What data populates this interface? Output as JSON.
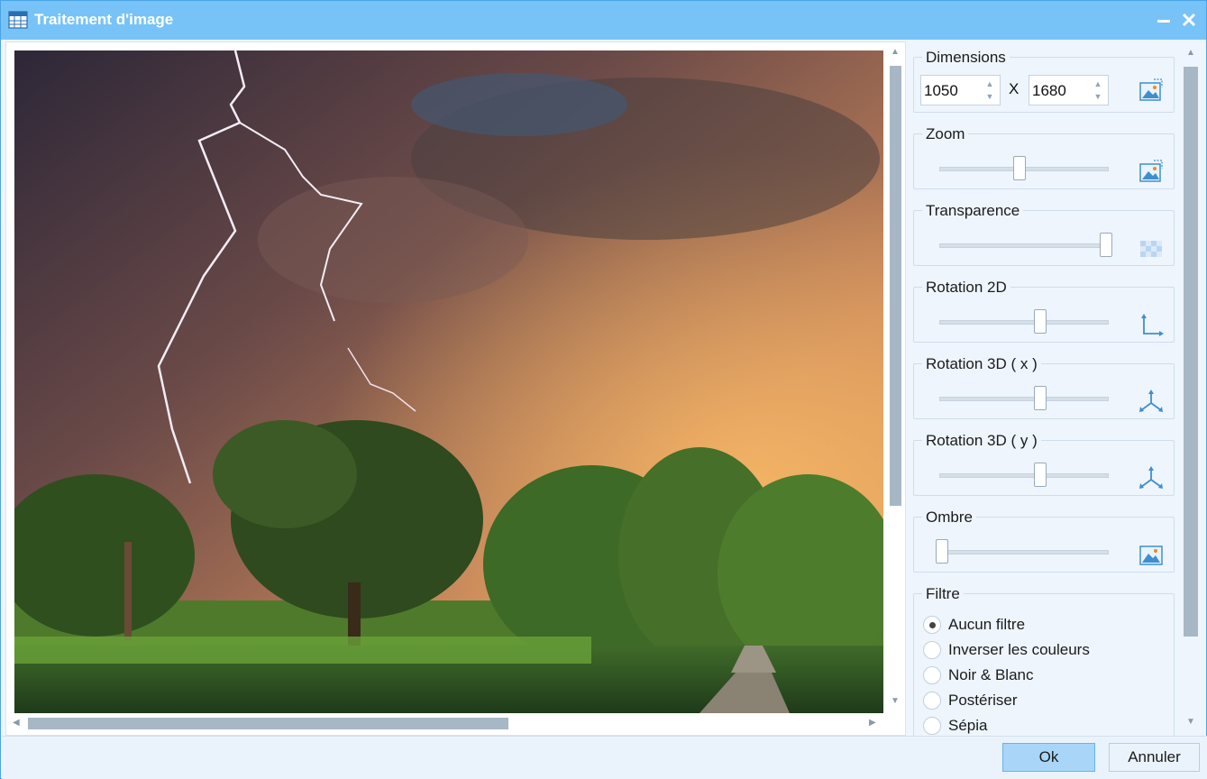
{
  "window": {
    "title": "Traitement d'image"
  },
  "dimensions": {
    "legend": "Dimensions",
    "width": "1050",
    "separator": "X",
    "height": "1680"
  },
  "sliders": [
    {
      "legend": "Zoom",
      "level": 0.47,
      "icon": "image-resize-icon"
    },
    {
      "legend": "Transparence",
      "level": 1.0,
      "icon": "transparency-checker-icon"
    },
    {
      "legend": "Rotation 2D",
      "level": 0.6,
      "icon": "rotation-2d-axes-icon"
    },
    {
      "legend": "Rotation 3D ( x )",
      "level": 0.6,
      "icon": "rotation-3d-axes-icon"
    },
    {
      "legend": "Rotation 3D ( y )",
      "level": 0.6,
      "icon": "rotation-3d-axes-icon"
    },
    {
      "legend": "Ombre",
      "level": 0.0,
      "icon": "image-shadow-icon"
    }
  ],
  "filter": {
    "legend": "Filtre",
    "selected": "Aucun filtre",
    "options": [
      "Aucun filtre",
      "Inverser les couleurs",
      "Noir & Blanc",
      "Postériser",
      "Sépia"
    ]
  },
  "buttons": {
    "ok": "Ok",
    "cancel": "Annuler"
  },
  "colors": {
    "titlebar": "#77c3f7",
    "accent": "#69b3ea",
    "scroll_thumb": "#a7b7c6"
  }
}
